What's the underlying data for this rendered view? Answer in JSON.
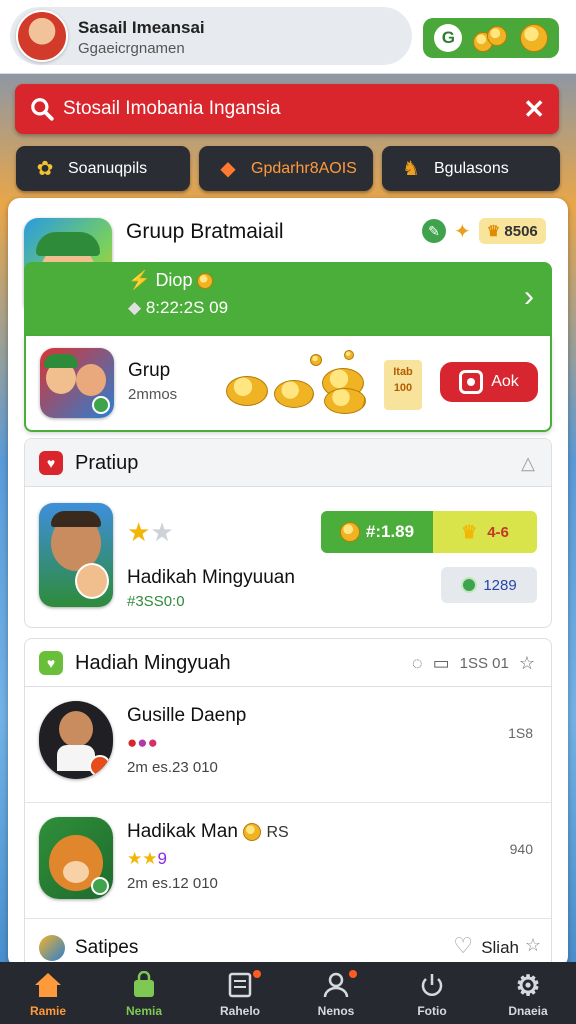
{
  "profile": {
    "name": "Sasail Imeansai",
    "subtitle": "Ggaeicrgnamen"
  },
  "top_actions": {
    "badge": "G"
  },
  "search": {
    "text": "Stosail Imobania Ingansia",
    "close_label": "✕"
  },
  "chips": [
    {
      "label": "Soanuqpils"
    },
    {
      "label": "Gpdarhr8AOIS"
    },
    {
      "label": "Bgulasons"
    }
  ],
  "featured": {
    "title": "Gruup Bratmaiail",
    "score": "8506",
    "drop_label": "Diop",
    "drop_time": "8:22:2S 09",
    "group_title": "Grup",
    "group_sub": "2mmos",
    "mini_card_top": "Itab",
    "mini_card_bottom": "100",
    "button_label": "Aok"
  },
  "pratiup": {
    "title": "Pratiup",
    "person_name": "Hadikah Mingyuuan",
    "person_code": "#3SS0:0",
    "stat_green": "#:1.89",
    "stat_yellow": "4-6",
    "stat_grey": "1289"
  },
  "weekly": {
    "title": "Hadiah Mingyuah",
    "right_text": "1SS 01",
    "rows": [
      {
        "title": "Gusille Daenp",
        "meta": "",
        "time": "2m es.23 010",
        "num": "1S8"
      },
      {
        "title": "Hadikak Man",
        "suffix": "RS",
        "meta": "9",
        "time": "2m es.12 010",
        "num": "940"
      }
    ]
  },
  "footer_row": {
    "title": "Satipes",
    "right": "Sliah"
  },
  "nav": [
    {
      "label": "Ramie"
    },
    {
      "label": "Nemia"
    },
    {
      "label": "Rahelo"
    },
    {
      "label": "Nenos"
    },
    {
      "label": "Fotio"
    },
    {
      "label": "Dnaeia"
    }
  ],
  "colors": {
    "accent_red": "#d9262c",
    "accent_green": "#4cae3a",
    "nav_bg": "#26292f",
    "active_orange": "#ff9a3c"
  }
}
